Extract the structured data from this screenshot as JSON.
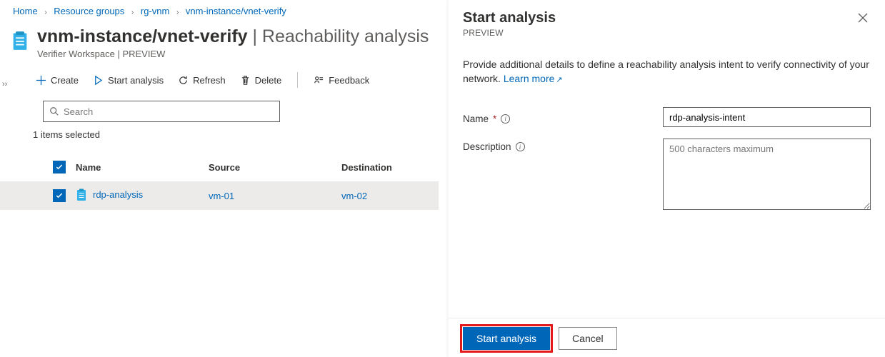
{
  "breadcrumb": {
    "items": [
      {
        "label": "Home"
      },
      {
        "label": "Resource groups"
      },
      {
        "label": "rg-vnm"
      },
      {
        "label": "vnm-instance/vnet-verify"
      }
    ]
  },
  "title": {
    "main": "vnm-instance/vnet-verify",
    "suffix": " | Reachability analysis",
    "subtitle": "Verifier Workspace | PREVIEW"
  },
  "toolbar": {
    "create": "Create",
    "start_analysis": "Start analysis",
    "refresh": "Refresh",
    "delete": "Delete",
    "feedback": "Feedback"
  },
  "search": {
    "placeholder": "Search"
  },
  "selected_text": "1 items selected",
  "grid": {
    "headers": {
      "name": "Name",
      "source": "Source",
      "destination": "Destination"
    },
    "rows": [
      {
        "name": "rdp-analysis",
        "source": "vm-01",
        "destination": "vm-02",
        "checked": true
      }
    ]
  },
  "panel": {
    "title": "Start analysis",
    "preview": "PREVIEW",
    "description_pre": "Provide additional details to define a reachability analysis intent to verify connectivity of your network. ",
    "learn_more": "Learn more",
    "name_label": "Name",
    "name_value": "rdp-analysis-intent",
    "description_label": "Description",
    "description_placeholder": "500 characters maximum",
    "start_btn": "Start analysis",
    "cancel_btn": "Cancel"
  }
}
